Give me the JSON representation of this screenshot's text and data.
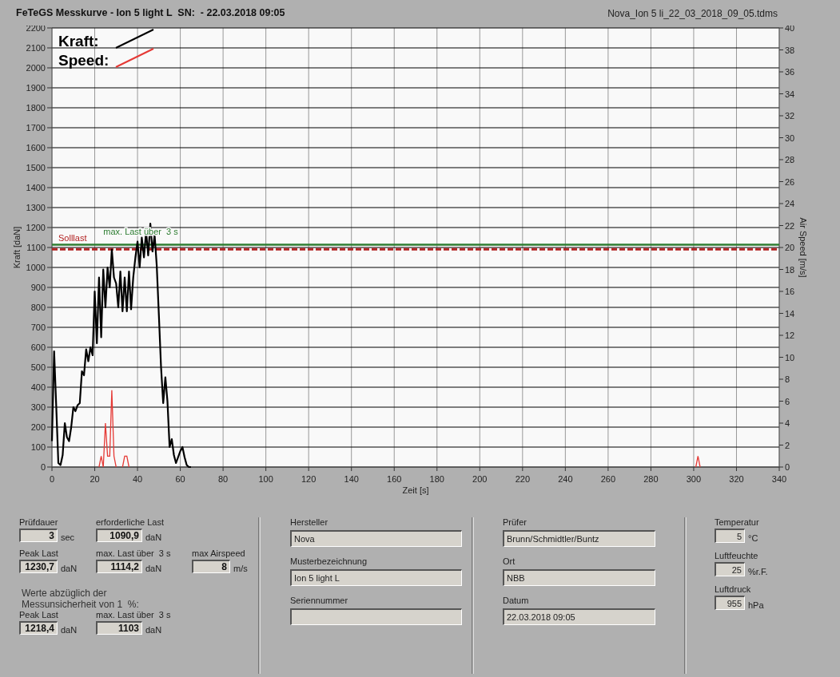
{
  "header": {
    "title": "FeTeGS Messkurve - Ion 5 light L  SN:  - 22.03.2018 09:05",
    "file": "Nova_Ion 5 li_22_03_2018_09_05.tdms"
  },
  "chart_data": {
    "type": "line",
    "xlabel": "Zeit [s]",
    "ylabel": "Kraft [daN]",
    "y2label": "Air Speed [m/s]",
    "x": [
      0,
      1,
      2,
      3,
      4,
      5,
      6,
      7,
      8,
      9,
      10,
      11,
      12,
      13,
      14,
      15,
      16,
      17,
      18,
      19,
      20,
      21,
      22,
      23,
      24,
      25,
      26,
      27,
      28,
      29,
      30,
      31,
      32,
      33,
      34,
      35,
      36,
      37,
      38,
      39,
      40,
      41,
      42,
      43,
      44,
      45,
      46,
      47,
      48,
      49,
      50,
      51,
      52,
      53,
      54,
      55,
      56,
      57,
      58,
      59,
      60,
      61,
      62,
      63,
      64,
      65,
      301,
      302,
      303
    ],
    "series": [
      {
        "name": "Kraft:",
        "color": "#000000",
        "values": [
          130,
          580,
          300,
          20,
          10,
          60,
          220,
          150,
          130,
          200,
          300,
          280,
          310,
          320,
          480,
          460,
          590,
          530,
          600,
          560,
          880,
          620,
          950,
          650,
          990,
          800,
          1000,
          900,
          1090,
          950,
          920,
          800,
          980,
          780,
          950,
          780,
          980,
          790,
          950,
          1050,
          1130,
          1000,
          1150,
          1050,
          1180,
          1060,
          1220,
          1080,
          1160,
          1010,
          760,
          500,
          320,
          450,
          330,
          100,
          140,
          60,
          20,
          50,
          80,
          100,
          50,
          10,
          0,
          0,
          null,
          null,
          null
        ]
      },
      {
        "name": "Speed:",
        "color": "#e53935",
        "axis": "y2",
        "values": [
          null,
          null,
          null,
          null,
          null,
          null,
          null,
          null,
          null,
          null,
          null,
          null,
          null,
          null,
          null,
          null,
          null,
          null,
          null,
          null,
          null,
          null,
          0,
          1,
          0,
          4,
          1,
          1,
          7,
          1,
          0,
          null,
          null,
          0,
          1,
          1,
          0,
          null,
          null,
          null,
          null,
          null,
          null,
          null,
          null,
          null,
          null,
          null,
          null,
          null,
          null,
          null,
          null,
          null,
          null,
          null,
          null,
          null,
          null,
          null,
          null,
          null,
          null,
          null,
          null,
          null,
          0,
          1,
          0
        ]
      }
    ],
    "xlim": [
      0,
      340
    ],
    "ylim": [
      0,
      2200
    ],
    "y2lim": [
      0,
      40
    ],
    "xticks": [
      0,
      20,
      40,
      60,
      80,
      100,
      120,
      140,
      160,
      180,
      200,
      220,
      240,
      260,
      280,
      300,
      320,
      340
    ],
    "yticks": [
      0,
      100,
      200,
      300,
      400,
      500,
      600,
      700,
      800,
      900,
      1000,
      1100,
      1200,
      1300,
      1400,
      1500,
      1600,
      1700,
      1800,
      1900,
      2000,
      2100,
      2200
    ],
    "y2ticks": [
      0,
      2,
      4,
      6,
      8,
      10,
      12,
      14,
      16,
      18,
      20,
      22,
      24,
      26,
      28,
      30,
      32,
      34,
      36,
      38,
      40
    ],
    "grid": true,
    "legend": true,
    "ref_lines": [
      {
        "axis": "y",
        "value": 1090.9,
        "label": "Solllast",
        "color": "#b22222"
      },
      {
        "axis": "y",
        "value": 1114.2,
        "label": "max. Last über  3 s",
        "color": "#2e7d32"
      }
    ]
  },
  "results": [
    {
      "label": "Prüfdauer",
      "value": "3",
      "unit": "sec"
    },
    {
      "label": "erforderliche Last",
      "value": "1090,9",
      "unit": "daN"
    },
    {
      "label": "Peak Last",
      "value": "1230,7",
      "unit": "daN"
    },
    {
      "label": "max. Last über  3 s",
      "value": "1114,2",
      "unit": "daN"
    },
    {
      "label": "max Airspeed",
      "value": "8",
      "unit": "m/s"
    }
  ],
  "corrected": {
    "note": "Werte abzüglich der Messunsicherheit von 1  %:",
    "items": [
      {
        "label": "Peak Last",
        "value": "1218,4",
        "unit": "daN"
      },
      {
        "label": "max. Last über  3 s",
        "value": "1103",
        "unit": "daN"
      }
    ]
  },
  "product": [
    {
      "label": "Hersteller",
      "value": "Nova"
    },
    {
      "label": "Musterbezeichnung",
      "value": "Ion 5 light L"
    },
    {
      "label": "Seriennummer"
    }
  ],
  "test": [
    {
      "label": "Prüfer",
      "value": "Brunn/Schmidtler/Buntz"
    },
    {
      "label": "Ort",
      "value": "NBB"
    },
    {
      "label": "Datum",
      "value": "22.03.2018 09:05"
    }
  ],
  "conditions": [
    {
      "label": "Temperatur",
      "value": "5",
      "unit": "°C"
    },
    {
      "label": "Luftfeuchte",
      "value": "25",
      "unit": "%r.F."
    },
    {
      "label": "Luftdruck",
      "value": "955",
      "unit": "hPa"
    }
  ]
}
